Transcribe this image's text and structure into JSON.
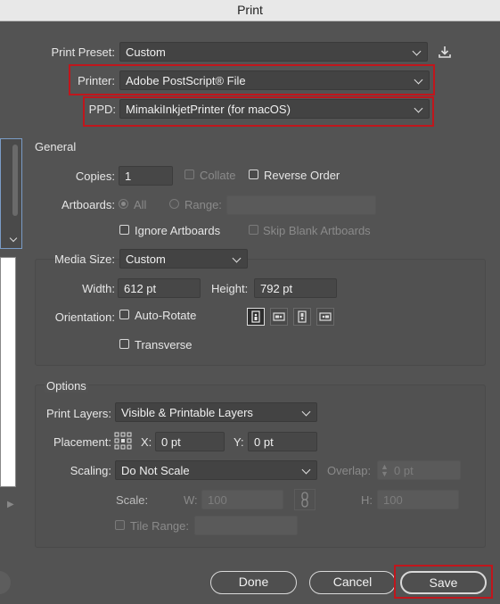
{
  "window": {
    "title": "Print"
  },
  "top": {
    "preset_label": "Print Preset:",
    "preset_value": "Custom",
    "printer_label": "Printer:",
    "printer_value": "Adobe PostScript® File",
    "ppd_label": "PPD:",
    "ppd_value": "MimakiInkjetPrinter (for macOS)",
    "save_preset_icon": "download-icon"
  },
  "general": {
    "title": "General",
    "copies_label": "Copies:",
    "copies_value": "1",
    "collate_label": "Collate",
    "collate_checked": false,
    "collate_enabled": false,
    "reverse_label": "Reverse Order",
    "reverse_checked": false,
    "artboards_label": "Artboards:",
    "all_label": "All",
    "range_label": "Range:",
    "range_value": "",
    "ignore_label": "Ignore Artboards",
    "ignore_checked": false,
    "skip_label": "Skip Blank Artboards",
    "skip_checked": false
  },
  "media": {
    "size_label": "Media Size:",
    "size_value": "Custom",
    "width_label": "Width:",
    "width_value": "612 pt",
    "height_label": "Height:",
    "height_value": "792 pt",
    "orientation_label": "Orientation:",
    "autorotate_label": "Auto-Rotate",
    "autorotate_checked": false,
    "transverse_label": "Transverse",
    "transverse_checked": false,
    "orientation_icons": [
      "portrait-icon",
      "landscape-left-icon",
      "portrait-flipped-icon",
      "landscape-right-icon"
    ]
  },
  "options": {
    "title": "Options",
    "layers_label": "Print Layers:",
    "layers_value": "Visible & Printable Layers",
    "placement_label": "Placement:",
    "x_label": "X:",
    "x_value": "0 pt",
    "y_label": "Y:",
    "y_value": "0 pt",
    "scaling_label": "Scaling:",
    "scaling_value": "Do Not Scale",
    "overlap_label": "Overlap:",
    "overlap_value": "0 pt",
    "scale_label": "Scale:",
    "w_label": "W:",
    "w_value": "100",
    "h_label": "H:",
    "h_value": "100",
    "tile_label": "Tile Range:",
    "tile_value": "",
    "tile_checked": false
  },
  "buttons": {
    "done": "Done",
    "cancel": "Cancel",
    "save": "Save"
  },
  "colors": {
    "background": "#535353",
    "highlight": "#c0161c"
  }
}
